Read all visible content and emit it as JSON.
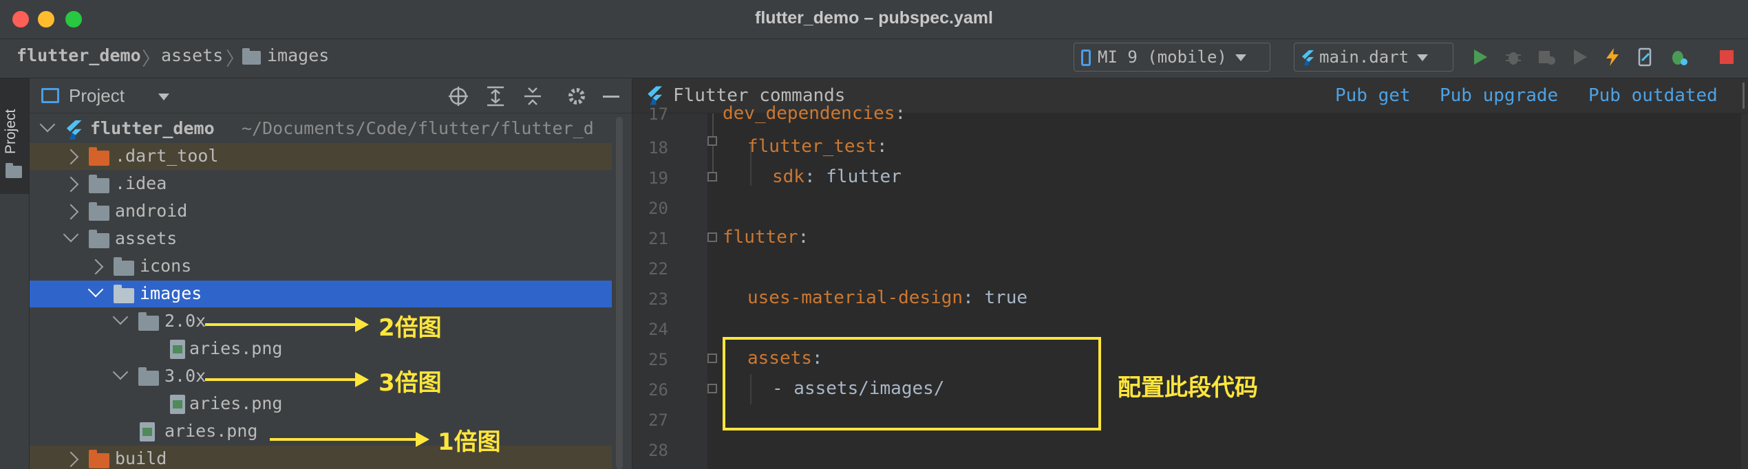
{
  "window": {
    "title": "flutter_demo – pubspec.yaml"
  },
  "breadcrumb": {
    "project": "flutter_demo",
    "assets": "assets",
    "images": "images"
  },
  "toolbar": {
    "device": "MI 9 (mobile)",
    "run_config": "main.dart"
  },
  "stripe": {
    "label": "Project"
  },
  "project_panel": {
    "title": "Project",
    "root": {
      "name": "flutter_demo",
      "path": "~/Documents/Code/flutter/flutter_d"
    },
    "items": [
      {
        "label": ".dart_tool"
      },
      {
        "label": ".idea"
      },
      {
        "label": "android"
      },
      {
        "label": "assets"
      },
      {
        "label": "icons"
      },
      {
        "label": "images"
      },
      {
        "label": "2.0x"
      },
      {
        "label": "aries.png"
      },
      {
        "label": "3.0x"
      },
      {
        "label": "aries.png"
      },
      {
        "label": "aries.png"
      },
      {
        "label": "build"
      }
    ]
  },
  "editor": {
    "banner_title": "Flutter commands",
    "actions": {
      "pub_get": "Pub get",
      "pub_upgrade": "Pub upgrade",
      "pub_outdated": "Pub outdated"
    },
    "lines": [
      {
        "no": "17",
        "key": "dev_dependencies",
        "sep": ":",
        "val": ""
      },
      {
        "no": "18",
        "key": "flutter_test",
        "sep": ":",
        "val": ""
      },
      {
        "no": "19",
        "key": "sdk",
        "sep": ":",
        "val": " flutter"
      },
      {
        "no": "20",
        "key": "",
        "sep": "",
        "val": ""
      },
      {
        "no": "21",
        "key": "flutter",
        "sep": ":",
        "val": ""
      },
      {
        "no": "22",
        "key": "",
        "sep": "",
        "val": ""
      },
      {
        "no": "23",
        "key": "uses-material-design",
        "sep": ":",
        "val": " true"
      },
      {
        "no": "24",
        "key": "",
        "sep": "",
        "val": ""
      },
      {
        "no": "25",
        "key": "assets",
        "sep": ":",
        "val": ""
      },
      {
        "no": "26",
        "key": "",
        "sep": "",
        "val": "- assets/images/"
      },
      {
        "no": "27",
        "key": "",
        "sep": "",
        "val": ""
      },
      {
        "no": "28",
        "key": "",
        "sep": "",
        "val": ""
      }
    ]
  },
  "annotations": {
    "x2": "2倍图",
    "x3": "3倍图",
    "x1": "1倍图",
    "config": "配置此段代码",
    "color": "#ffe63c"
  }
}
